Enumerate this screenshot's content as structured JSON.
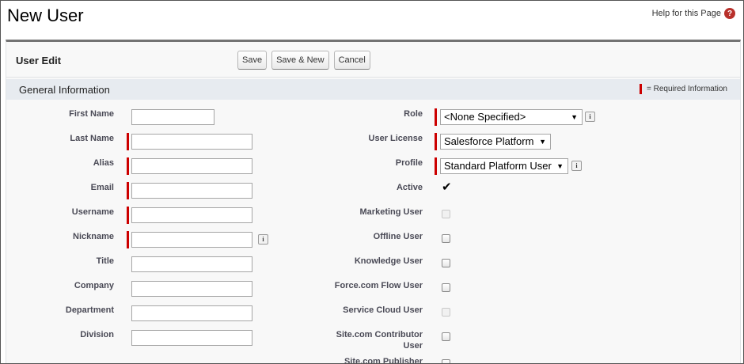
{
  "page": {
    "title": "New User",
    "help_text": "Help for this Page"
  },
  "edit": {
    "title": "User Edit",
    "buttons": {
      "save": "Save",
      "save_new": "Save & New",
      "cancel": "Cancel"
    }
  },
  "section": {
    "title": "General Information",
    "required_legend": "= Required Information"
  },
  "left_fields": {
    "first_name": {
      "label": "First Name",
      "value": ""
    },
    "last_name": {
      "label": "Last Name",
      "value": ""
    },
    "alias": {
      "label": "Alias",
      "value": ""
    },
    "email": {
      "label": "Email",
      "value": ""
    },
    "username": {
      "label": "Username",
      "value": ""
    },
    "nickname": {
      "label": "Nickname",
      "value": ""
    },
    "title": {
      "label": "Title",
      "value": ""
    },
    "company": {
      "label": "Company",
      "value": ""
    },
    "department": {
      "label": "Department",
      "value": ""
    },
    "division": {
      "label": "Division",
      "value": ""
    }
  },
  "right_fields": {
    "role": {
      "label": "Role",
      "value": "<None Specified>"
    },
    "user_license": {
      "label": "User License",
      "value": "Salesforce Platform"
    },
    "profile": {
      "label": "Profile",
      "value": "Standard Platform User"
    },
    "active": {
      "label": "Active",
      "checked": true
    },
    "marketing_user": {
      "label": "Marketing User",
      "checked": false,
      "disabled": true
    },
    "offline_user": {
      "label": "Offline User",
      "checked": false
    },
    "knowledge_user": {
      "label": "Knowledge User",
      "checked": false
    },
    "flow_user": {
      "label": "Force.com Flow User",
      "checked": false
    },
    "service_cloud_user": {
      "label": "Service Cloud User",
      "checked": false,
      "disabled": true
    },
    "site_contributor": {
      "label_line1": "Site.com Contributor",
      "label_line2": "User",
      "checked": false
    },
    "site_publisher": {
      "label": "Site.com Publisher",
      "checked": false
    }
  },
  "icons": {
    "help": "help-circle-icon",
    "info": "info-icon",
    "check": "checkmark-icon"
  },
  "colors": {
    "required": "#cc0000",
    "section_bg": "#e7ebf0",
    "panel_border": "#737373"
  }
}
